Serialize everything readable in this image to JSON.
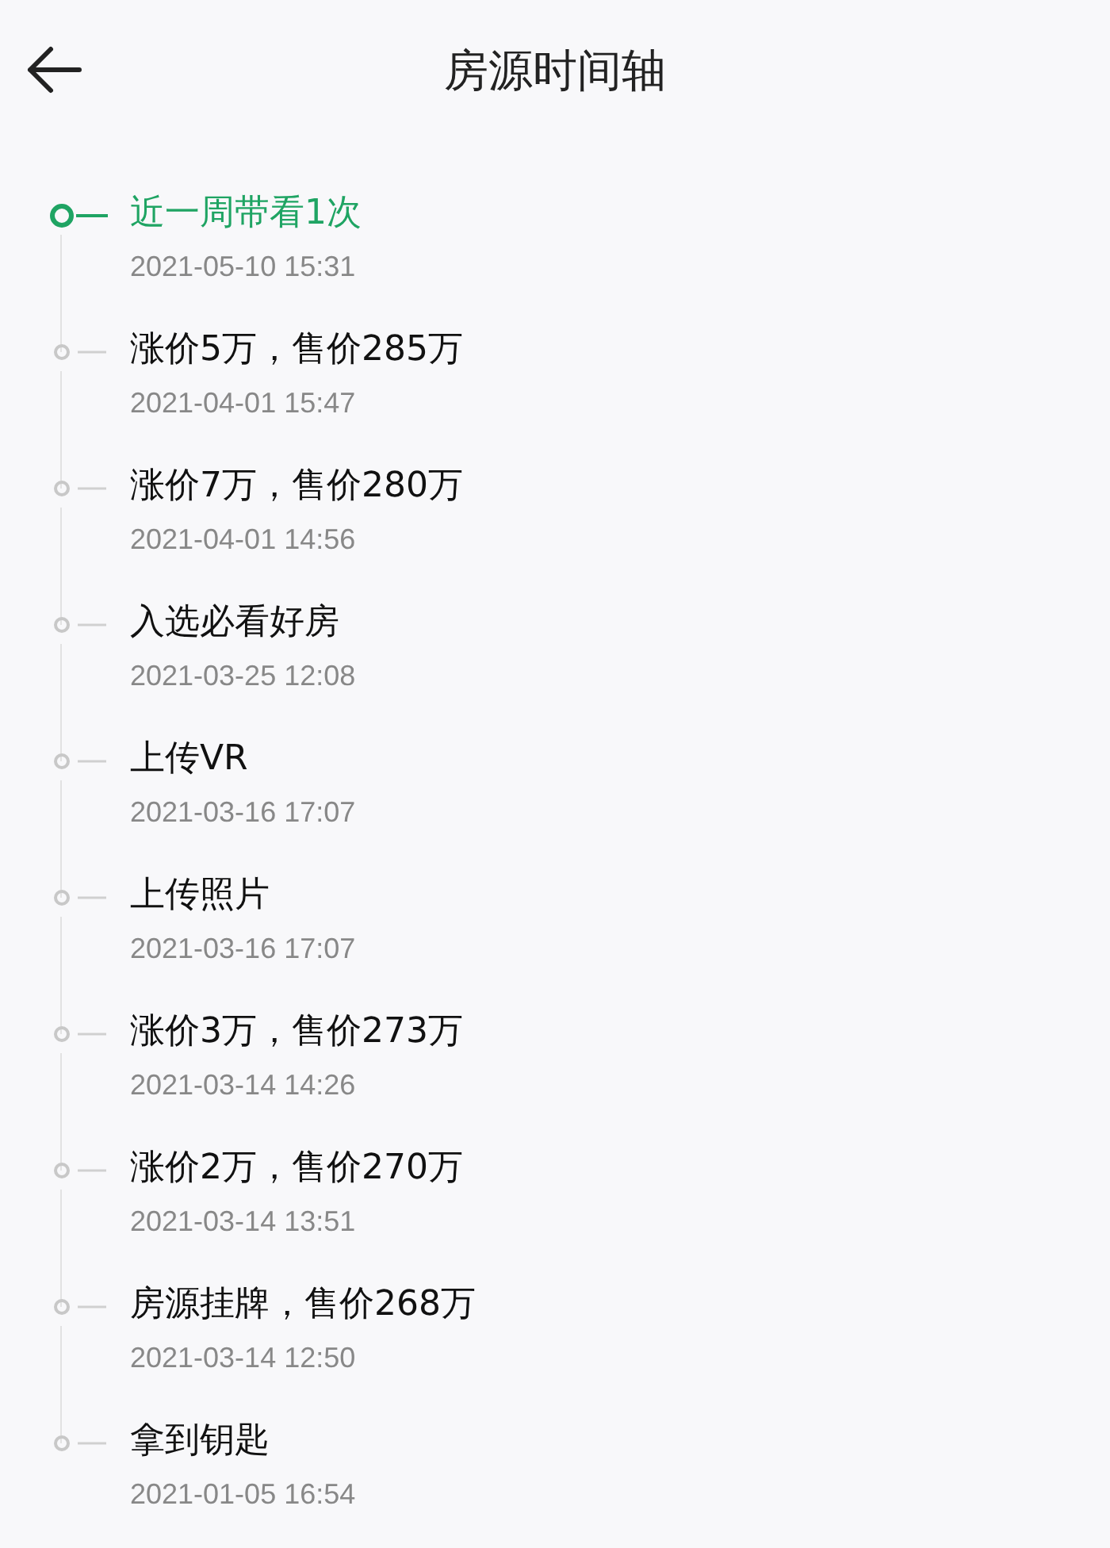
{
  "header": {
    "title": "房源时间轴"
  },
  "events": [
    {
      "title": "近一周带看1次",
      "time": "2021-05-10 15:31",
      "highlighted": true
    },
    {
      "title": "涨价5万，售价285万",
      "time": "2021-04-01 15:47",
      "highlighted": false
    },
    {
      "title": "涨价7万，售价280万",
      "time": "2021-04-01 14:56",
      "highlighted": false
    },
    {
      "title": "入选必看好房",
      "time": "2021-03-25 12:08",
      "highlighted": false
    },
    {
      "title": "上传VR",
      "time": "2021-03-16 17:07",
      "highlighted": false
    },
    {
      "title": "上传照片",
      "time": "2021-03-16 17:07",
      "highlighted": false
    },
    {
      "title": "涨价3万，售价273万",
      "time": "2021-03-14 14:26",
      "highlighted": false
    },
    {
      "title": "涨价2万，售价270万",
      "time": "2021-03-14 13:51",
      "highlighted": false
    },
    {
      "title": "房源挂牌，售价268万",
      "time": "2021-03-14 12:50",
      "highlighted": false
    },
    {
      "title": "拿到钥匙",
      "time": "2021-01-05 16:54",
      "highlighted": false
    }
  ]
}
